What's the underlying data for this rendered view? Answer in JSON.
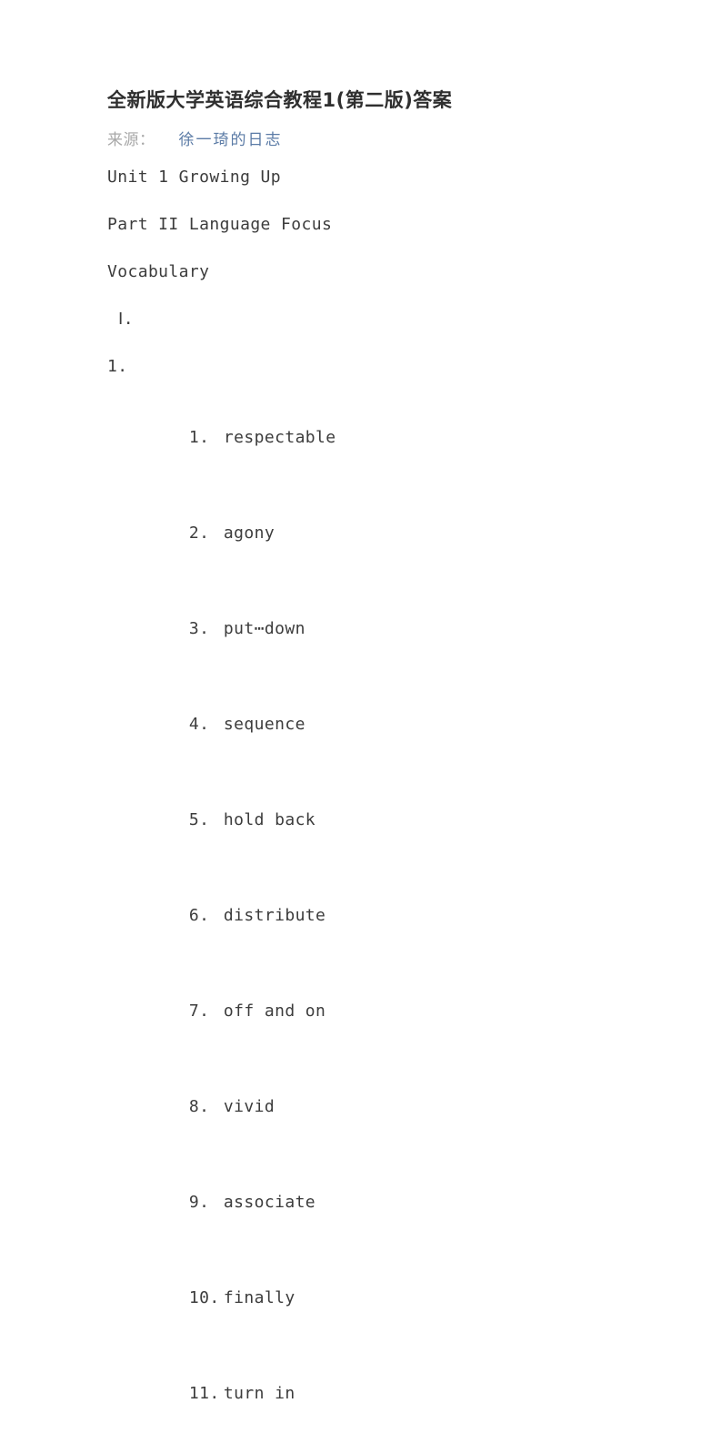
{
  "document": {
    "title": "全新版大学英语综合教程1(第二版)答案",
    "source": {
      "label": "来源：",
      "link_text": "徐一琦的日志",
      "label_color": "#a8a8a8",
      "link_color": "#5b7ba6"
    },
    "headings": {
      "unit": "Unit 1 Growing Up",
      "part": "Part II Language Focus",
      "section": "Vocabulary",
      "roman_numeral": "Ⅰ.",
      "sub_number": "1."
    },
    "vocabulary": {
      "items": [
        {
          "num": "1.",
          "word": "respectable"
        },
        {
          "num": "2.",
          "word": "agony"
        },
        {
          "num": "3.",
          "word": "put⋯down"
        },
        {
          "num": "4.",
          "word": "sequence"
        },
        {
          "num": "5.",
          "word": "hold back"
        },
        {
          "num": "6.",
          "word": "distribute"
        },
        {
          "num": "7.",
          "word": "off and on"
        },
        {
          "num": "8.",
          "word": "vivid"
        },
        {
          "num": "9.",
          "word": "associate"
        },
        {
          "num": "10.",
          "word": "finally"
        },
        {
          "num": "11.",
          "word": "turn in"
        }
      ]
    },
    "colors": {
      "background": "#ffffff",
      "title_text": "#2f2f2f",
      "body_text": "#3c3c3c"
    }
  }
}
